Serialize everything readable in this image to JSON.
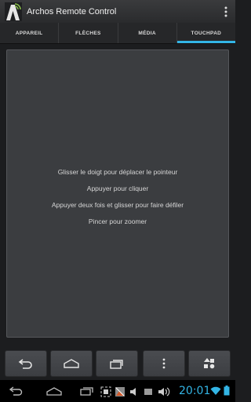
{
  "app": {
    "title": "Archos Remote Control"
  },
  "tabs": [
    {
      "label": "APPAREIL",
      "active": false
    },
    {
      "label": "FLÈCHES",
      "active": false
    },
    {
      "label": "MÉDIA",
      "active": false
    },
    {
      "label": "TOUCHPAD",
      "active": true
    }
  ],
  "touchpad": {
    "instructions": [
      "Glisser le doigt pour déplacer le pointeur",
      "Appuyer pour cliquer",
      "Appuyer deux fois et glisser pour faire défiler",
      "Pincer pour zoomer"
    ]
  },
  "controls": [
    {
      "icon": "back-icon"
    },
    {
      "icon": "home-icon"
    },
    {
      "icon": "recent-apps-icon"
    },
    {
      "icon": "menu-icon"
    },
    {
      "icon": "settings-shapes-icon"
    }
  ],
  "system_bar": {
    "time": "20:01",
    "accent_color": "#33b5e5"
  }
}
